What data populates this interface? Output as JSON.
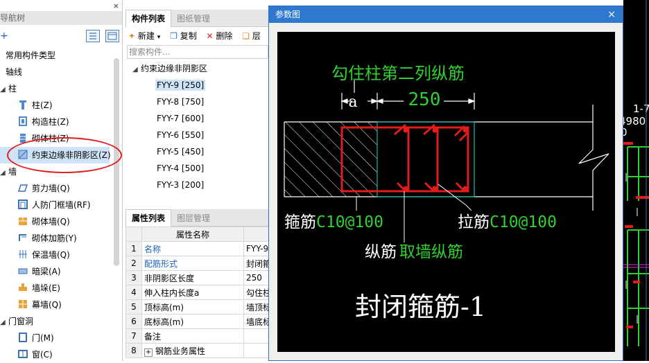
{
  "nav": {
    "title": "导航树",
    "close": "×",
    "items": [
      {
        "label": "常用构件类型"
      },
      {
        "label": "轴线"
      },
      {
        "label": "柱"
      },
      {
        "label": "柱(Z)"
      },
      {
        "label": "构造柱(Z)"
      },
      {
        "label": "砌体柱(Z)"
      },
      {
        "label": "约束边缘非阴影区(Z)"
      },
      {
        "label": "墙"
      },
      {
        "label": "剪力墙(Q)"
      },
      {
        "label": "人防门框墙(RF)"
      },
      {
        "label": "砌体墙(Q)"
      },
      {
        "label": "砌体加筋(Y)"
      },
      {
        "label": "保温墙(Q)"
      },
      {
        "label": "暗梁(A)"
      },
      {
        "label": "墙垛(E)"
      },
      {
        "label": "幕墙(Q)"
      },
      {
        "label": "门窗洞"
      },
      {
        "label": "门(M)"
      },
      {
        "label": "窗(C)"
      }
    ]
  },
  "components": {
    "tabs": [
      "构件列表",
      "图纸管理"
    ],
    "toolbar": {
      "new": "新建",
      "copy": "复制",
      "delete": "删除",
      "layer": "层"
    },
    "search_placeholder": "搜索构件...",
    "group": "约束边缘非阴影区",
    "items": [
      "FYY-9 [250]",
      "FYY-8 [750]",
      "FYY-7 [600]",
      "FYY-6 [550]",
      "FYY-5 [450]",
      "FYY-4 [500]",
      "FYY-3 [200]"
    ]
  },
  "properties": {
    "tabs": [
      "属性列表",
      "图层管理"
    ],
    "header": "属性名称",
    "rows": [
      {
        "n": "1",
        "name": "名称",
        "value": "FYY-9"
      },
      {
        "n": "2",
        "name": "配筋形式",
        "value": "封闭箍筋"
      },
      {
        "n": "3",
        "name": "非阴影区长度",
        "value": "250"
      },
      {
        "n": "4",
        "name": "伸入柱内长度a",
        "value": "勾住柱第"
      },
      {
        "n": "5",
        "name": "顶标高(m)",
        "value": "墙顶标高"
      },
      {
        "n": "6",
        "name": "底标高(m)",
        "value": "墙底标高"
      },
      {
        "n": "7",
        "name": "备注",
        "value": ""
      },
      {
        "n": "8",
        "name": "钢筋业务属性",
        "value": ""
      }
    ],
    "expand": "+"
  },
  "dialog": {
    "title": "参数图",
    "close": "×",
    "drawing": {
      "top_label": "勾住柱第二列纵筋",
      "dim_a": "a",
      "dim_250": "250",
      "stirrup_prefix": "箍筋",
      "stirrup_value": "C10@100",
      "tie_prefix": "拉筋",
      "tie_value": "C10@100",
      "long_prefix": "纵筋",
      "long_value": "取墙纵筋",
      "caption": "封闭箍筋-1"
    }
  },
  "rightcad": {
    "text1": "1-7",
    "text2": "4980",
    "text3": "0"
  },
  "colors": {
    "green": "#2fd12f",
    "red": "#e21c1c",
    "cyan": "#1fb5b5",
    "accent": "#2f78d0"
  }
}
